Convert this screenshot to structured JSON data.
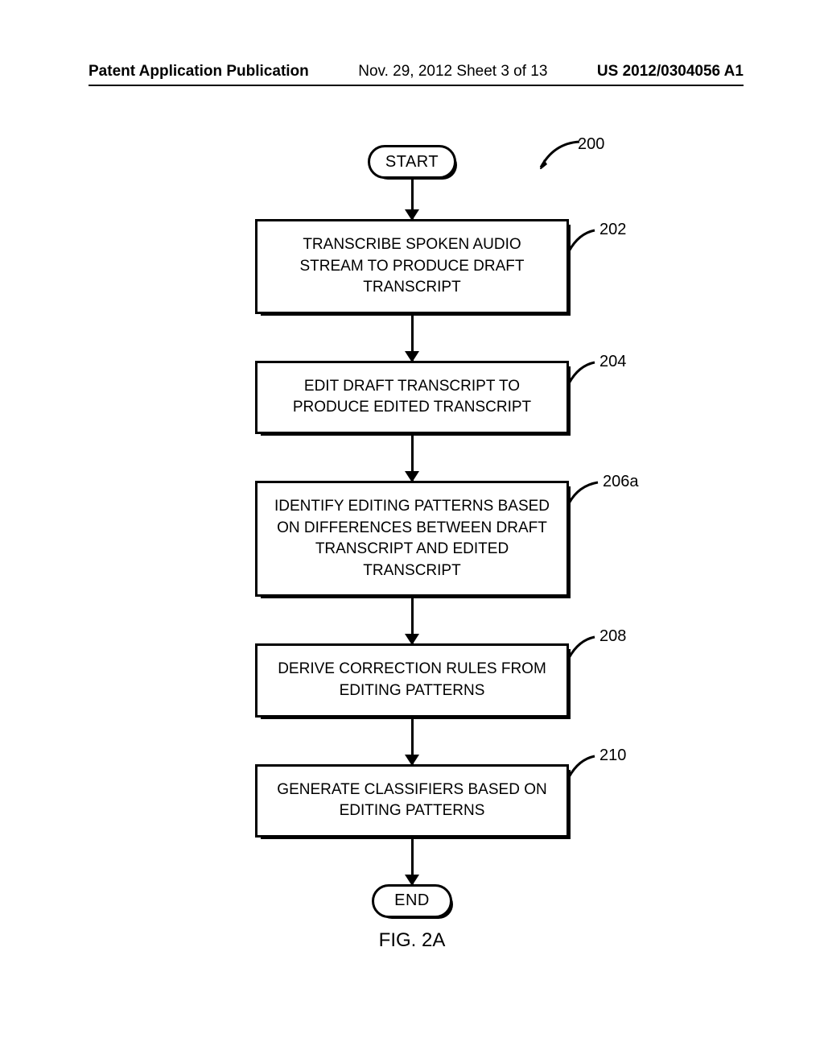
{
  "header": {
    "left": "Patent Application Publication",
    "mid": "Nov. 29, 2012  Sheet 3 of 13",
    "right": "US 2012/0304056 A1"
  },
  "chart_data": {
    "type": "flowchart",
    "title": "FIG. 2A",
    "overall_ref": "200",
    "nodes": [
      {
        "id": "start",
        "kind": "terminator",
        "text": "START"
      },
      {
        "id": "202",
        "kind": "process",
        "ref": "202",
        "text": "TRANSCRIBE SPOKEN AUDIO STREAM TO PRODUCE DRAFT TRANSCRIPT"
      },
      {
        "id": "204",
        "kind": "process",
        "ref": "204",
        "text": "EDIT DRAFT TRANSCRIPT TO PRODUCE EDITED TRANSCRIPT"
      },
      {
        "id": "206a",
        "kind": "process",
        "ref": "206a",
        "text": "IDENTIFY EDITING PATTERNS BASED ON DIFFERENCES BETWEEN DRAFT TRANSCRIPT AND EDITED TRANSCRIPT"
      },
      {
        "id": "208",
        "kind": "process",
        "ref": "208",
        "text": "DERIVE CORRECTION RULES FROM EDITING PATTERNS"
      },
      {
        "id": "210",
        "kind": "process",
        "ref": "210",
        "text": "GENERATE CLASSIFIERS BASED ON EDITING PATTERNS"
      },
      {
        "id": "end",
        "kind": "terminator",
        "text": "END"
      }
    ],
    "edges": [
      [
        "start",
        "202"
      ],
      [
        "202",
        "204"
      ],
      [
        "204",
        "206a"
      ],
      [
        "206a",
        "208"
      ],
      [
        "208",
        "210"
      ],
      [
        "210",
        "end"
      ]
    ]
  },
  "terminators": {
    "start": "START",
    "end": "END"
  },
  "steps": {
    "s202": {
      "ref": "202",
      "text": "TRANSCRIBE SPOKEN AUDIO STREAM TO PRODUCE DRAFT TRANSCRIPT"
    },
    "s204": {
      "ref": "204",
      "text": "EDIT DRAFT TRANSCRIPT TO PRODUCE EDITED TRANSCRIPT"
    },
    "s206a": {
      "ref": "206a",
      "text": "IDENTIFY EDITING PATTERNS BASED ON DIFFERENCES BETWEEN DRAFT TRANSCRIPT AND EDITED TRANSCRIPT"
    },
    "s208": {
      "ref": "208",
      "text": "DERIVE CORRECTION RULES FROM EDITING PATTERNS"
    },
    "s210": {
      "ref": "210",
      "text": "GENERATE CLASSIFIERS BASED ON EDITING PATTERNS"
    }
  },
  "refs": {
    "overall": "200"
  },
  "figure_label": "FIG. 2A"
}
